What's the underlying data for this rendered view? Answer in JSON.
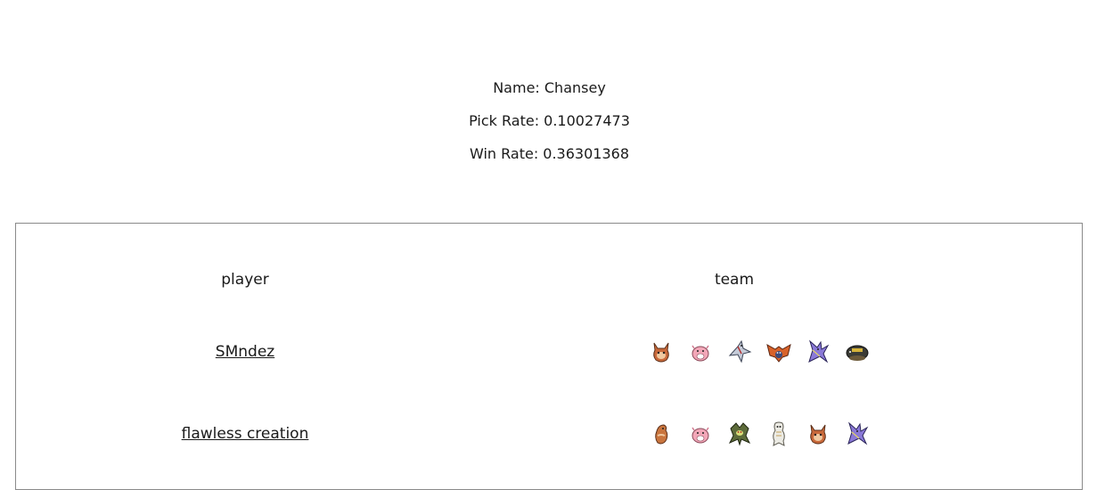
{
  "pokemon": {
    "name_line": "Name: Chansey",
    "pick_rate_line": "Pick Rate: 0.10027473",
    "win_rate_line": "Win Rate: 0.36301368"
  },
  "table": {
    "headers": {
      "player": "player",
      "team": "team"
    },
    "rows": [
      {
        "player": "SMndez",
        "team_icons": [
          "orange-fox-sprite-icon",
          "pink-chansey-sprite-icon",
          "silver-bird-sprite-icon",
          "orange-bat-sprite-icon",
          "purple-dragon-sprite-icon",
          "dark-turtle-sprite-icon"
        ]
      },
      {
        "player": "flawless creation",
        "team_icons": [
          "orange-seahorse-sprite-icon",
          "pink-chansey-sprite-icon",
          "green-dark-sprite-icon",
          "white-ghost-sprite-icon",
          "orange-fox-sprite-icon",
          "purple-dragon-sprite-icon"
        ]
      }
    ]
  },
  "colors": {
    "border": "#8a8a8a",
    "text": "#1a1a1a",
    "background": "#ffffff"
  }
}
